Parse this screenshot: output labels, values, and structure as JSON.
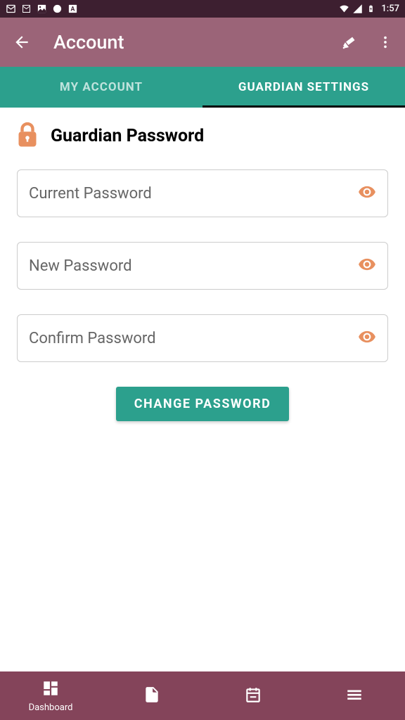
{
  "status_bar": {
    "time": "1:57"
  },
  "app_bar": {
    "title": "Account"
  },
  "tabs": {
    "my_account": "MY ACCOUNT",
    "guardian_settings": "GUARDIAN SETTINGS"
  },
  "section": {
    "title": "Guardian Password"
  },
  "fields": {
    "current": "Current Password",
    "new": "New Password",
    "confirm": "Confirm Password"
  },
  "button": {
    "change": "CHANGE PASSWORD"
  },
  "nav": {
    "dashboard": "Dashboard"
  },
  "colors": {
    "accent_teal": "#2ca08d",
    "accent_mauve": "#9b6478",
    "bottom_nav": "#84445a",
    "lock_orange": "#e8905f",
    "eye_orange": "#e8905f"
  }
}
